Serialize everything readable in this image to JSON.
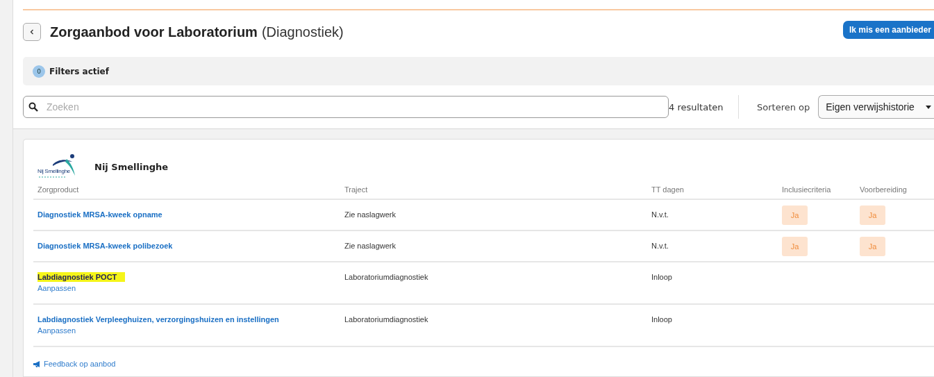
{
  "header": {
    "title": "Zorgaanbod voor Laboratorium",
    "subtitle": "(Diagnostiek)",
    "action_button": "Ik mis een aanbieder"
  },
  "filters": {
    "count": "0",
    "label": "Filters actief"
  },
  "search": {
    "placeholder": "Zoeken",
    "results": "4 resultaten",
    "sort_label": "Sorteren op",
    "sort_value": "Eigen verwijshistorie"
  },
  "provider": {
    "logo_text": "Nij Smellinghe",
    "name": "Nij Smellinghe"
  },
  "table": {
    "columns": [
      "Zorgproduct",
      "Traject",
      "TT dagen",
      "Inclusiecriteria",
      "Voorbereiding"
    ],
    "rows": [
      {
        "product": "Diagnostiek MRSA-kweek opname",
        "highlighted": false,
        "traject": "Zie naslagwerk",
        "tt_dagen": "N.v.t.",
        "inclusiecriteria": "Ja",
        "voorbereiding": "Ja"
      },
      {
        "product": "Diagnostiek MRSA-kweek polibezoek",
        "highlighted": false,
        "traject": "Zie naslagwerk",
        "tt_dagen": "N.v.t.",
        "inclusiecriteria": "Ja",
        "voorbereiding": "Ja"
      },
      {
        "product": "Labdiagnostiek POCT",
        "highlighted": true,
        "edit_link": "Aanpassen",
        "traject": "Laboratoriumdiagnostiek",
        "tt_dagen": "Inloop"
      },
      {
        "product": "Labdiagnostiek Verpleeghuizen, verzorgingshuizen en instellingen",
        "highlighted": false,
        "edit_link": "Aanpassen",
        "traject": "Laboratoriumdiagnostiek",
        "tt_dagen": "Inloop"
      }
    ]
  },
  "feedback_link": "Feedback op aanbod"
}
